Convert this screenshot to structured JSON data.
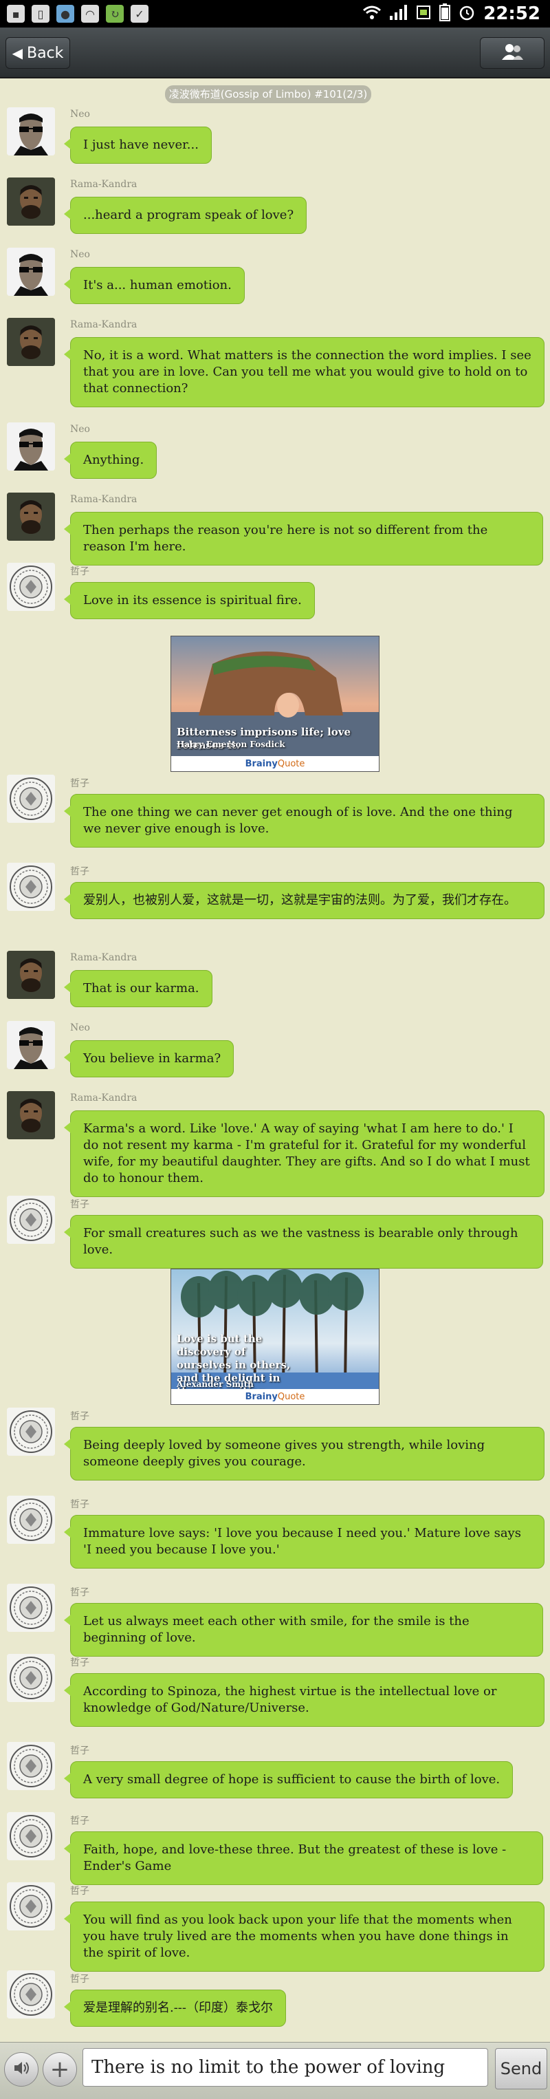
{
  "status_bar": {
    "time": "22:52"
  },
  "header": {
    "back_label": "Back",
    "chat_title": "凌波微布道(Gossip of Limbo) #101(2/3)"
  },
  "messages": [
    {
      "sender": "Neo",
      "text": "I just have never..."
    },
    {
      "sender": "Rama-Kandra",
      "text": "...heard a program speak of love?"
    },
    {
      "sender": "Neo",
      "text": "It's a... human emotion."
    },
    {
      "sender": "Rama-Kandra",
      "text": "No, it is a word. What matters is the connection the word implies. I see that you are in love. Can you tell me what you would give to hold on to that connection?"
    },
    {
      "sender": "Neo",
      "text": "Anything."
    },
    {
      "sender": "Rama-Kandra",
      "text": "Then perhaps the reason you're here is not so different from the reason I'm here."
    },
    {
      "sender": "哲子",
      "text": "Love in its essence is spiritual fire."
    },
    {
      "sender": "哲子",
      "text": "The one thing we can never get enough of is love. And the one thing we never give enough is love."
    },
    {
      "sender": "哲子",
      "text": "爱别人，也被别人爱，这就是一切，这就是宇宙的法则。为了爱，我们才存在。"
    },
    {
      "sender": "Rama-Kandra",
      "text": "That is our karma."
    },
    {
      "sender": "Neo",
      "text": "You believe in karma?"
    },
    {
      "sender": "Rama-Kandra",
      "text": "Karma's a word. Like 'love.' A way of saying 'what I am here to do.' I do not resent my karma - I'm grateful for it. Grateful for my wonderful wife, for my beautiful daughter. They are gifts. And so I do what I must do to honour them."
    },
    {
      "sender": "哲子",
      "text": "For small creatures such as we the vastness is bearable only through love."
    },
    {
      "sender": "哲子",
      "text": "Being deeply loved by someone gives you strength, while loving someone deeply gives you courage."
    },
    {
      "sender": "哲子",
      "text": "Immature love says: 'I love you because I need you.' Mature love says 'I need you because I love you.'"
    },
    {
      "sender": "哲子",
      "text": "Let us always meet each other with smile, for the smile is the beginning of love."
    },
    {
      "sender": "哲子",
      "text": "According to Spinoza, the highest virtue is the intellectual love or knowledge of God/Nature/Universe."
    },
    {
      "sender": "哲子",
      "text": "A very small degree of hope is sufficient to cause the birth of love."
    },
    {
      "sender": "哲子",
      "text": "Faith, hope, and love-these three. But the greatest of these is love - Ender's Game"
    },
    {
      "sender": "哲子",
      "text": "You will find as you look back upon your life that the moments when you have truly lived are the moments when you have done things in the spirit of love."
    },
    {
      "sender": "哲子",
      "text": "爱是理解的别名.---（印度）泰戈尔"
    }
  ],
  "images": [
    {
      "quote": "Bitterness imprisons life; love releases it.",
      "author": "Harry Emerson Fosdick",
      "brand_a": "Brainy",
      "brand_b": "Quote"
    },
    {
      "quote": "Love is but the discovery of ourselves in others, and the delight in the recognition.",
      "author": "Alexander Smith",
      "brand_a": "Brainy",
      "brand_b": "Quote"
    }
  ],
  "input": {
    "value": "There is no limit to the power of loving",
    "send_label": "Send"
  }
}
